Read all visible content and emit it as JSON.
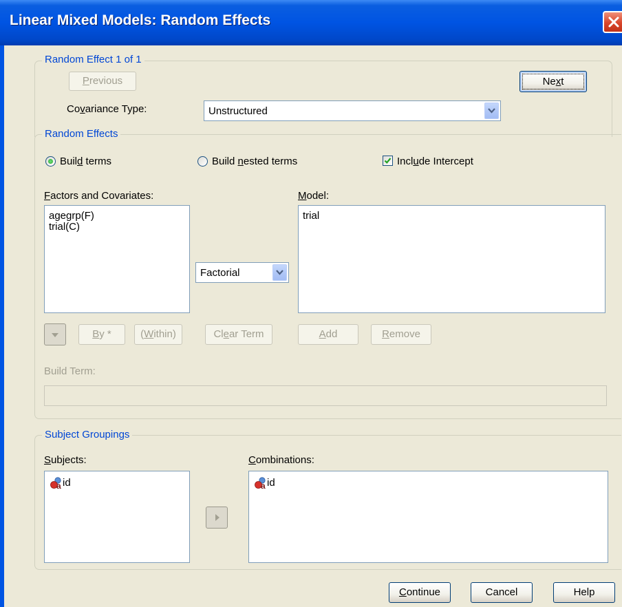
{
  "window": {
    "title": "Linear Mixed Models: Random Effects"
  },
  "random_effect_group": {
    "label": "Random Effect 1 of 1",
    "previous": {
      "pre": "",
      "u": "P",
      "post": "revious"
    },
    "next": {
      "pre": "Ne",
      "u": "x",
      "post": "t"
    },
    "covariance_label": {
      "pre": "Co",
      "u": "v",
      "post": "ariance Type:"
    },
    "covariance_value": "Unstructured"
  },
  "random_effects_group": {
    "label": "Random Effects",
    "build_terms": {
      "pre": "Buil",
      "u": "d",
      "post": " terms"
    },
    "build_nested": {
      "pre": "Build ",
      "u": "n",
      "post": "ested terms"
    },
    "include_intercept": {
      "pre": "Incl",
      "u": "u",
      "post": "de Intercept"
    },
    "factors_label": {
      "pre": "",
      "u": "F",
      "post": "actors and Covariates:"
    },
    "factors_items": [
      "agegrp(F)",
      "trial(C)"
    ],
    "model_label": {
      "pre": "",
      "u": "M",
      "post": "odel:"
    },
    "model_items": [
      "trial"
    ],
    "factorial_value": "Factorial",
    "by_button": {
      "pre": "",
      "u": "B",
      "post": "y *"
    },
    "within_button": {
      "pre": "(",
      "u": "W",
      "post": "ithin)"
    },
    "clear_term": {
      "pre": "Cl",
      "u": "e",
      "post": "ar Term"
    },
    "add": {
      "pre": "",
      "u": "A",
      "post": "dd"
    },
    "remove": {
      "pre": "",
      "u": "R",
      "post": "emove"
    },
    "build_term_label": "Build Term:"
  },
  "subject_groupings": {
    "label": "Subject Groupings",
    "subjects_label": {
      "pre": "",
      "u": "S",
      "post": "ubjects:"
    },
    "subjects_items": [
      "id"
    ],
    "combinations_label": {
      "pre": "",
      "u": "C",
      "post": "ombinations:"
    },
    "combinations_items": [
      "id"
    ]
  },
  "footer": {
    "continue": {
      "pre": "",
      "u": "C",
      "post": "ontinue"
    },
    "cancel": "Cancel",
    "help": "Help"
  },
  "colors": {
    "titlebar": "#0054e3",
    "group_label": "#0046d5",
    "dialog_bg": "#ece9d8"
  },
  "icons": {
    "close": "close-icon",
    "dropdown": "chevron-down-icon",
    "arrow_down": "arrow-down-icon",
    "arrow_right": "arrow-right-icon",
    "variable": "nominal-variable-icon"
  }
}
